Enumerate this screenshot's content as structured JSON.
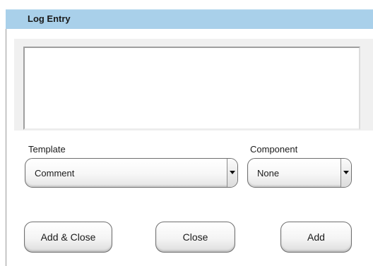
{
  "window": {
    "title": "Log Entry"
  },
  "log_entry": {
    "text": ""
  },
  "template": {
    "label": "Template",
    "selected": "Comment"
  },
  "component": {
    "label": "Component",
    "selected": "None"
  },
  "buttons": {
    "add_close": "Add & Close",
    "close": "Close",
    "add": "Add"
  },
  "colors": {
    "header_bg": "#a9d0ea",
    "panel_bg": "#f0f0f0"
  }
}
